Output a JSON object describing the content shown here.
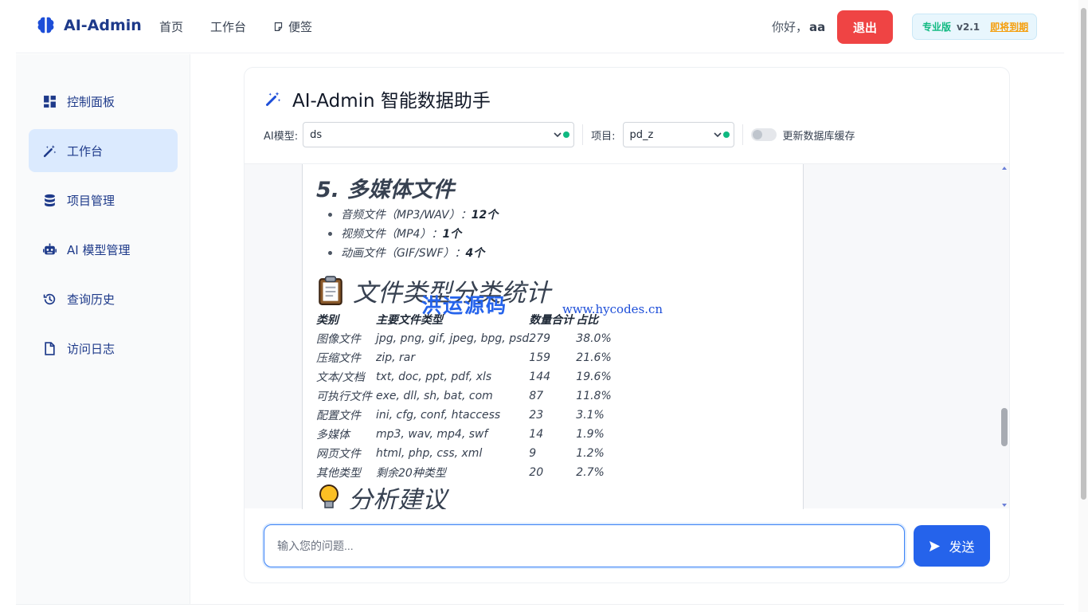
{
  "brand": {
    "name": "AI-Admin"
  },
  "nav": [
    {
      "label": "首页"
    },
    {
      "label": "工作台"
    },
    {
      "label": "便签"
    }
  ],
  "user": {
    "greeting": "你好，",
    "name": "aa",
    "logout_label": "退出"
  },
  "license": {
    "edition": "专业版",
    "version": "v2.1",
    "status": "即将到期"
  },
  "sidebar": {
    "items": [
      {
        "label": "控制面板",
        "icon": "dashboard-icon"
      },
      {
        "label": "工作台",
        "icon": "magic-wand-icon",
        "active": true
      },
      {
        "label": "项目管理",
        "icon": "database-icon"
      },
      {
        "label": "AI 模型管理",
        "icon": "robot-icon"
      },
      {
        "label": "查询历史",
        "icon": "history-icon"
      },
      {
        "label": "访问日志",
        "icon": "file-icon"
      }
    ]
  },
  "assistant": {
    "title": "AI-Admin 智能数据助手",
    "model_label": "AI模型:",
    "model_value": "ds",
    "project_label": "项目:",
    "project_value": "pd_z",
    "cache_toggle_label": "更新数据库缓存",
    "status_color": "#10b981"
  },
  "message": {
    "section5_title": "5. 多媒体文件",
    "bullets": [
      {
        "text": "音频文件（MP3/WAV）：",
        "count": "12个"
      },
      {
        "text": "视频文件（MP4）：",
        "count": "1个"
      },
      {
        "text": "动画文件（GIF/SWF）：",
        "count": "4个"
      }
    ],
    "stats_title": "文件类型分类统计",
    "table": {
      "headers": [
        "类别",
        "主要文件类型",
        "数量合计",
        "占比"
      ],
      "rows": [
        [
          "图像文件",
          "jpg, png, gif, jpeg, bpg, psd",
          "279",
          "38.0%"
        ],
        [
          "压缩文件",
          "zip, rar",
          "159",
          "21.6%"
        ],
        [
          "文本/文档",
          "txt, doc, ppt, pdf, xls",
          "144",
          "19.6%"
        ],
        [
          "可执行文件",
          "exe, dll, sh, bat, com",
          "87",
          "11.8%"
        ],
        [
          "配置文件",
          "ini, cfg, conf, htaccess",
          "23",
          "3.1%"
        ],
        [
          "多媒体",
          "mp3, wav, mp4, swf",
          "14",
          "1.9%"
        ],
        [
          "网页文件",
          "html, php, css, xml",
          "9",
          "1.2%"
        ],
        [
          "其他类型",
          "剩余20种类型",
          "20",
          "2.7%"
        ]
      ]
    },
    "advice_title": "分析建议"
  },
  "watermark": {
    "text": "洪运源码",
    "url": "www.hycodes.cn"
  },
  "composer": {
    "placeholder": "输入您的问题...",
    "send_label": "发送"
  },
  "colors": {
    "accent": "#2563eb",
    "danger": "#ef4444",
    "success": "#10b981",
    "warning": "#f59e0b"
  }
}
